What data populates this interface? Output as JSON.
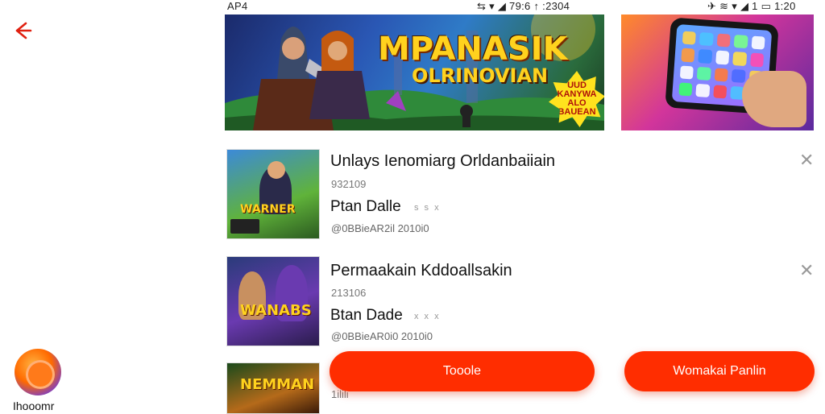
{
  "status_bar": {
    "left": "AP4",
    "middle": "⇆ ▾ ◢ 79:6 ↑ :2304",
    "right": "✈ ≋ ▾ ◢ 1 ▭ 1:20"
  },
  "back_icon": "arrow-left",
  "accent_color": "#ff2d00",
  "banner": {
    "title": "MPANASIK",
    "subtitle": "OLRINOVIAN",
    "badge_lines": [
      "UUD",
      "KANYWA",
      "ALO",
      "BAUEAN"
    ]
  },
  "list": [
    {
      "title": "Unlays Ienomiarg Orldanbaiiain",
      "number": "932109",
      "publisher": "Ptan Dalle",
      "stars": "s s x",
      "meta": "@0BBieAR2il  2010i0",
      "thumb_text": "WARNER"
    },
    {
      "title": "Permaakain Kddoallsakin",
      "number": "213106",
      "publisher": "Btan Dade",
      "stars": "x x x",
      "meta": "@0BBieAR0i0  2010i0",
      "thumb_text": "WANABS"
    },
    {
      "title": "",
      "number": "1ilili",
      "publisher": "",
      "stars": "",
      "meta": "",
      "thumb_text": "NEMMAN"
    }
  ],
  "buttons": {
    "primary": "Tooole",
    "secondary": "Womakai Panlin"
  },
  "app": {
    "label": "Ihooomr"
  }
}
